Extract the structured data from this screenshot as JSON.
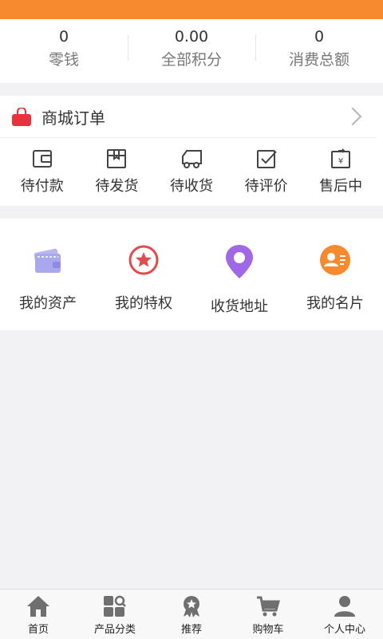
{
  "stats": [
    {
      "value": "0",
      "label": "零钱"
    },
    {
      "value": "0.00",
      "label": "全部积分"
    },
    {
      "value": "0",
      "label": "消费总额"
    }
  ],
  "orders": {
    "title": "商城订单",
    "items": [
      {
        "label": "待付款",
        "icon": "wallet-icon"
      },
      {
        "label": "待发货",
        "icon": "package-icon"
      },
      {
        "label": "待收货",
        "icon": "truck-icon"
      },
      {
        "label": "待评价",
        "icon": "review-check-icon"
      },
      {
        "label": "售后中",
        "icon": "after-sale-icon"
      }
    ]
  },
  "services": [
    {
      "label": "我的资产",
      "icon": "wallet-cards-icon",
      "color": "#a9a8ef"
    },
    {
      "label": "我的特权",
      "icon": "star-badge-icon",
      "color": "#e24b4b"
    },
    {
      "label": "收货地址",
      "icon": "location-pin-icon",
      "color": "#a067e6"
    },
    {
      "label": "我的名片",
      "icon": "contact-card-icon",
      "color": "#f7892e"
    }
  ],
  "tabs": [
    {
      "label": "首页",
      "icon": "home-icon"
    },
    {
      "label": "产品分类",
      "icon": "category-icon"
    },
    {
      "label": "推荐",
      "icon": "recommend-icon"
    },
    {
      "label": "购物车",
      "icon": "cart-icon"
    },
    {
      "label": "个人中心",
      "icon": "user-icon"
    }
  ],
  "colors": {
    "accent": "#f7892e",
    "background": "#f2f2f4"
  }
}
